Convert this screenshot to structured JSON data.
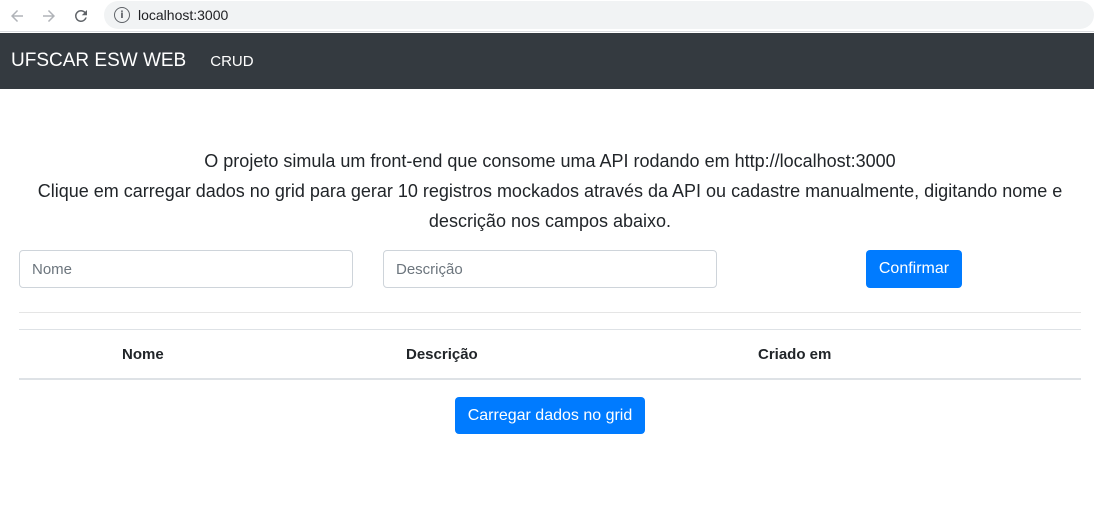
{
  "browser": {
    "url": "localhost:3000",
    "icons": [
      "back-arrow-icon",
      "forward-arrow-icon",
      "reload-icon",
      "info-icon"
    ]
  },
  "navbar": {
    "brand": "UFSCAR ESW WEB",
    "link": "CRUD"
  },
  "intro": {
    "line1": "O projeto simula um front-end que consome uma API rodando em http://localhost:3000",
    "line2": "Clique em carregar dados no grid para gerar 10 registros mockados através da API ou cadastre manualmente, digitando nome e descrição nos campos abaixo."
  },
  "form": {
    "nome_placeholder": "Nome",
    "nome_value": "",
    "descricao_placeholder": "Descrição",
    "descricao_value": "",
    "confirm_label": "Confirmar"
  },
  "table": {
    "columns": [
      "Nome",
      "Descrição",
      "Criado em"
    ],
    "rows": []
  },
  "load_button_label": "Carregar dados no grid",
  "colors": {
    "navbar": "#343a40",
    "primary": "#007bff"
  }
}
